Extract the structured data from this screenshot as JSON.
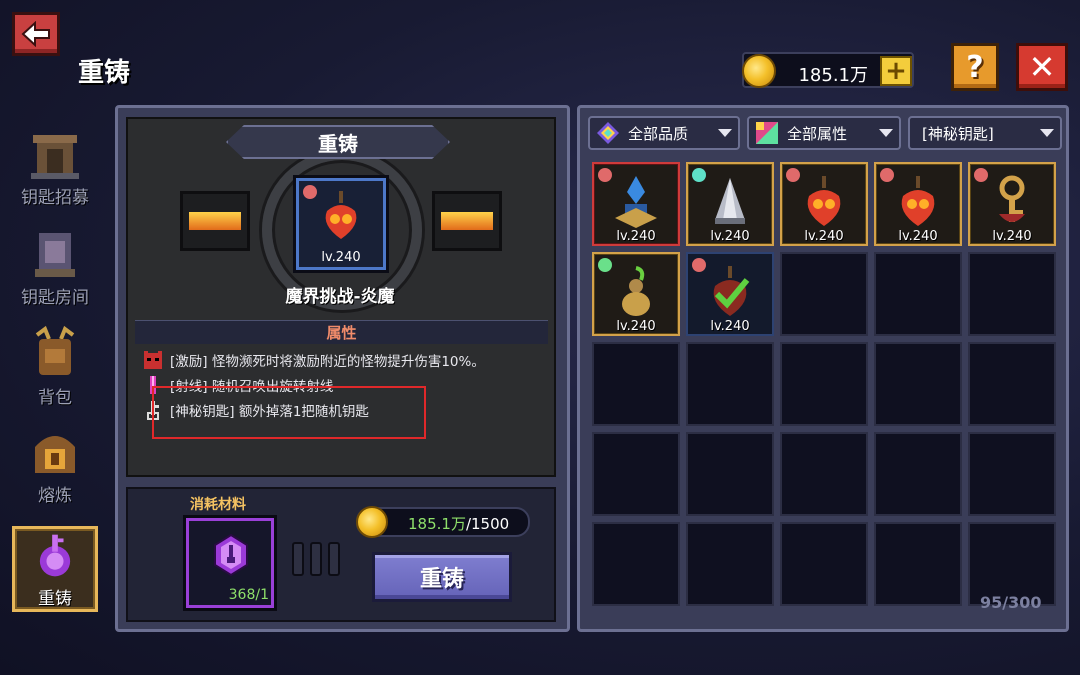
{
  "header": {
    "title": "重铸",
    "gold": "185.1万"
  },
  "sidebar": {
    "items": [
      {
        "label": "钥匙招募",
        "icon": "shrine-icon"
      },
      {
        "label": "钥匙房间",
        "icon": "room-icon"
      },
      {
        "label": "背包",
        "icon": "backpack-icon"
      },
      {
        "label": "熔炼",
        "icon": "smelt-icon"
      },
      {
        "label": "重铸",
        "icon": "reforge-key-icon",
        "active": true
      }
    ]
  },
  "reforge": {
    "header": "重铸",
    "item": {
      "level": "lv.240",
      "name": "魔界挑战-炎魔"
    },
    "attr_title": "属性",
    "attributes": [
      "[激励] 怪物濒死时将激励附近的怪物提升伤害10%。",
      "[射线] 随机召唤出旋转射线",
      "[神秘钥匙] 额外掉落1把随机钥匙"
    ],
    "consume_title": "消耗材料",
    "material_count": "368/1",
    "cost_have": "185.1万",
    "cost_need": "/1500",
    "button": "重铸"
  },
  "inventory": {
    "filters": [
      "全部品质",
      "全部属性",
      "[神秘钥匙]"
    ],
    "items": [
      {
        "level": "lv.240",
        "quality": "red",
        "dot": "#e06a6a"
      },
      {
        "level": "lv.240",
        "quality": "gold",
        "dot": "#5ee0c8"
      },
      {
        "level": "lv.240",
        "quality": "gold",
        "dot": "#e06a6a"
      },
      {
        "level": "lv.240",
        "quality": "gold",
        "dot": "#e06a6a"
      },
      {
        "level": "lv.240",
        "quality": "gold",
        "dot": "#e06a6a"
      },
      {
        "level": "lv.240",
        "quality": "gold",
        "dot": "#6ae08a"
      },
      {
        "level": "lv.240",
        "quality": "blue",
        "dot": "#e06a6a"
      }
    ],
    "capacity": "95/300"
  }
}
